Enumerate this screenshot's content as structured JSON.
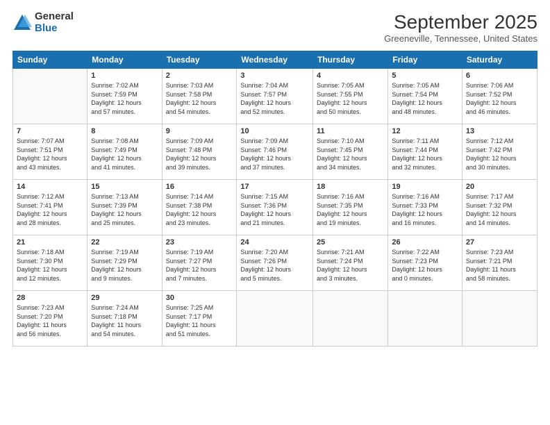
{
  "logo": {
    "general": "General",
    "blue": "Blue"
  },
  "title": "September 2025",
  "subtitle": "Greeneville, Tennessee, United States",
  "headers": [
    "Sunday",
    "Monday",
    "Tuesday",
    "Wednesday",
    "Thursday",
    "Friday",
    "Saturday"
  ],
  "weeks": [
    [
      {
        "day": "",
        "info": ""
      },
      {
        "day": "1",
        "info": "Sunrise: 7:02 AM\nSunset: 7:59 PM\nDaylight: 12 hours\nand 57 minutes."
      },
      {
        "day": "2",
        "info": "Sunrise: 7:03 AM\nSunset: 7:58 PM\nDaylight: 12 hours\nand 54 minutes."
      },
      {
        "day": "3",
        "info": "Sunrise: 7:04 AM\nSunset: 7:57 PM\nDaylight: 12 hours\nand 52 minutes."
      },
      {
        "day": "4",
        "info": "Sunrise: 7:05 AM\nSunset: 7:55 PM\nDaylight: 12 hours\nand 50 minutes."
      },
      {
        "day": "5",
        "info": "Sunrise: 7:05 AM\nSunset: 7:54 PM\nDaylight: 12 hours\nand 48 minutes."
      },
      {
        "day": "6",
        "info": "Sunrise: 7:06 AM\nSunset: 7:52 PM\nDaylight: 12 hours\nand 46 minutes."
      }
    ],
    [
      {
        "day": "7",
        "info": "Sunrise: 7:07 AM\nSunset: 7:51 PM\nDaylight: 12 hours\nand 43 minutes."
      },
      {
        "day": "8",
        "info": "Sunrise: 7:08 AM\nSunset: 7:49 PM\nDaylight: 12 hours\nand 41 minutes."
      },
      {
        "day": "9",
        "info": "Sunrise: 7:09 AM\nSunset: 7:48 PM\nDaylight: 12 hours\nand 39 minutes."
      },
      {
        "day": "10",
        "info": "Sunrise: 7:09 AM\nSunset: 7:46 PM\nDaylight: 12 hours\nand 37 minutes."
      },
      {
        "day": "11",
        "info": "Sunrise: 7:10 AM\nSunset: 7:45 PM\nDaylight: 12 hours\nand 34 minutes."
      },
      {
        "day": "12",
        "info": "Sunrise: 7:11 AM\nSunset: 7:44 PM\nDaylight: 12 hours\nand 32 minutes."
      },
      {
        "day": "13",
        "info": "Sunrise: 7:12 AM\nSunset: 7:42 PM\nDaylight: 12 hours\nand 30 minutes."
      }
    ],
    [
      {
        "day": "14",
        "info": "Sunrise: 7:12 AM\nSunset: 7:41 PM\nDaylight: 12 hours\nand 28 minutes."
      },
      {
        "day": "15",
        "info": "Sunrise: 7:13 AM\nSunset: 7:39 PM\nDaylight: 12 hours\nand 25 minutes."
      },
      {
        "day": "16",
        "info": "Sunrise: 7:14 AM\nSunset: 7:38 PM\nDaylight: 12 hours\nand 23 minutes."
      },
      {
        "day": "17",
        "info": "Sunrise: 7:15 AM\nSunset: 7:36 PM\nDaylight: 12 hours\nand 21 minutes."
      },
      {
        "day": "18",
        "info": "Sunrise: 7:16 AM\nSunset: 7:35 PM\nDaylight: 12 hours\nand 19 minutes."
      },
      {
        "day": "19",
        "info": "Sunrise: 7:16 AM\nSunset: 7:33 PM\nDaylight: 12 hours\nand 16 minutes."
      },
      {
        "day": "20",
        "info": "Sunrise: 7:17 AM\nSunset: 7:32 PM\nDaylight: 12 hours\nand 14 minutes."
      }
    ],
    [
      {
        "day": "21",
        "info": "Sunrise: 7:18 AM\nSunset: 7:30 PM\nDaylight: 12 hours\nand 12 minutes."
      },
      {
        "day": "22",
        "info": "Sunrise: 7:19 AM\nSunset: 7:29 PM\nDaylight: 12 hours\nand 9 minutes."
      },
      {
        "day": "23",
        "info": "Sunrise: 7:19 AM\nSunset: 7:27 PM\nDaylight: 12 hours\nand 7 minutes."
      },
      {
        "day": "24",
        "info": "Sunrise: 7:20 AM\nSunset: 7:26 PM\nDaylight: 12 hours\nand 5 minutes."
      },
      {
        "day": "25",
        "info": "Sunrise: 7:21 AM\nSunset: 7:24 PM\nDaylight: 12 hours\nand 3 minutes."
      },
      {
        "day": "26",
        "info": "Sunrise: 7:22 AM\nSunset: 7:23 PM\nDaylight: 12 hours\nand 0 minutes."
      },
      {
        "day": "27",
        "info": "Sunrise: 7:23 AM\nSunset: 7:21 PM\nDaylight: 11 hours\nand 58 minutes."
      }
    ],
    [
      {
        "day": "28",
        "info": "Sunrise: 7:23 AM\nSunset: 7:20 PM\nDaylight: 11 hours\nand 56 minutes."
      },
      {
        "day": "29",
        "info": "Sunrise: 7:24 AM\nSunset: 7:18 PM\nDaylight: 11 hours\nand 54 minutes."
      },
      {
        "day": "30",
        "info": "Sunrise: 7:25 AM\nSunset: 7:17 PM\nDaylight: 11 hours\nand 51 minutes."
      },
      {
        "day": "",
        "info": ""
      },
      {
        "day": "",
        "info": ""
      },
      {
        "day": "",
        "info": ""
      },
      {
        "day": "",
        "info": ""
      }
    ]
  ]
}
